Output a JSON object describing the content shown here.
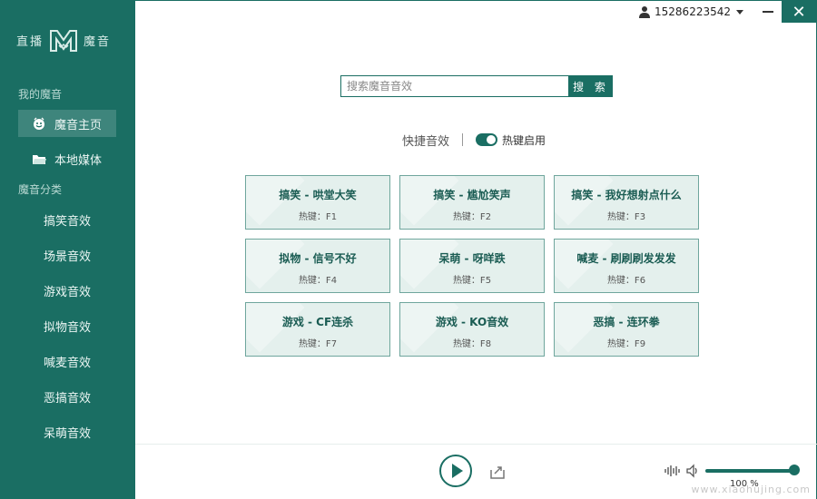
{
  "app": {
    "logo_left": "直播",
    "logo_right": "魔音"
  },
  "sidebar": {
    "section_mine": "我的魔音",
    "nav": [
      {
        "label": "魔音主页",
        "icon": "smiley-icon",
        "active": true
      },
      {
        "label": "本地媒体",
        "icon": "folder-icon",
        "active": false
      }
    ],
    "section_categories": "魔音分类",
    "categories": [
      "搞笑音效",
      "场景音效",
      "游戏音效",
      "拟物音效",
      "喊麦音效",
      "恶搞音效",
      "呆萌音效"
    ]
  },
  "topbar": {
    "user": "15286223542"
  },
  "search": {
    "placeholder": "搜索魔音音效",
    "button": "搜 索"
  },
  "quick": {
    "label": "快捷音效",
    "toggle_label": "热键启用",
    "toggle_on": true
  },
  "cards": [
    {
      "title": "搞笑 - 哄堂大笑",
      "hotkey": "热键：F1"
    },
    {
      "title": "搞笑 - 尴尬笑声",
      "hotkey": "热键：F2"
    },
    {
      "title": "搞笑 - 我好想射点什么",
      "hotkey": "热键：F3"
    },
    {
      "title": "拟物 - 信号不好",
      "hotkey": "热键：F4"
    },
    {
      "title": "呆萌 - 呀咩跌",
      "hotkey": "热键：F5"
    },
    {
      "title": "喊麦 - 刷刷刷发发发",
      "hotkey": "热键：F6"
    },
    {
      "title": "游戏 - CF连杀",
      "hotkey": "热键：F7"
    },
    {
      "title": "游戏 - KO音效",
      "hotkey": "热键：F8"
    },
    {
      "title": "恶搞 - 连环拳",
      "hotkey": "热键：F9"
    }
  ],
  "player": {
    "volume_label": "100 %",
    "volume": 1.0
  },
  "watermark": "www.xiaohujing.com",
  "colors": {
    "primary": "#1a6e63",
    "card_bg": "#e4f0ed"
  }
}
